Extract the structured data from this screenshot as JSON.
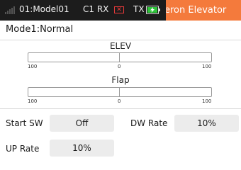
{
  "status_bar": {
    "model": "01:Model01",
    "rx_label": "C1 RX",
    "rx_status_glyph": "✕",
    "rx_status_color": "#e83a3a",
    "tx_label": "TX",
    "tx_battery_color": "#2ec43a",
    "scrolling_title": "eron  Elevator",
    "title_bg_color": "#f47a3c"
  },
  "mode": "Mode1:Normal",
  "bars": [
    {
      "label": "ELEV",
      "left_tick": "100",
      "center_tick": "0",
      "right_tick": "100",
      "value": 0
    },
    {
      "label": "Flap",
      "left_tick": "100",
      "center_tick": "0",
      "right_tick": "100",
      "value": 0
    }
  ],
  "settings": {
    "start_sw": {
      "label": "Start SW",
      "value": "Off"
    },
    "dw_rate": {
      "label": "DW Rate",
      "value": "10%"
    },
    "up_rate": {
      "label": "UP Rate",
      "value": "10%"
    }
  }
}
